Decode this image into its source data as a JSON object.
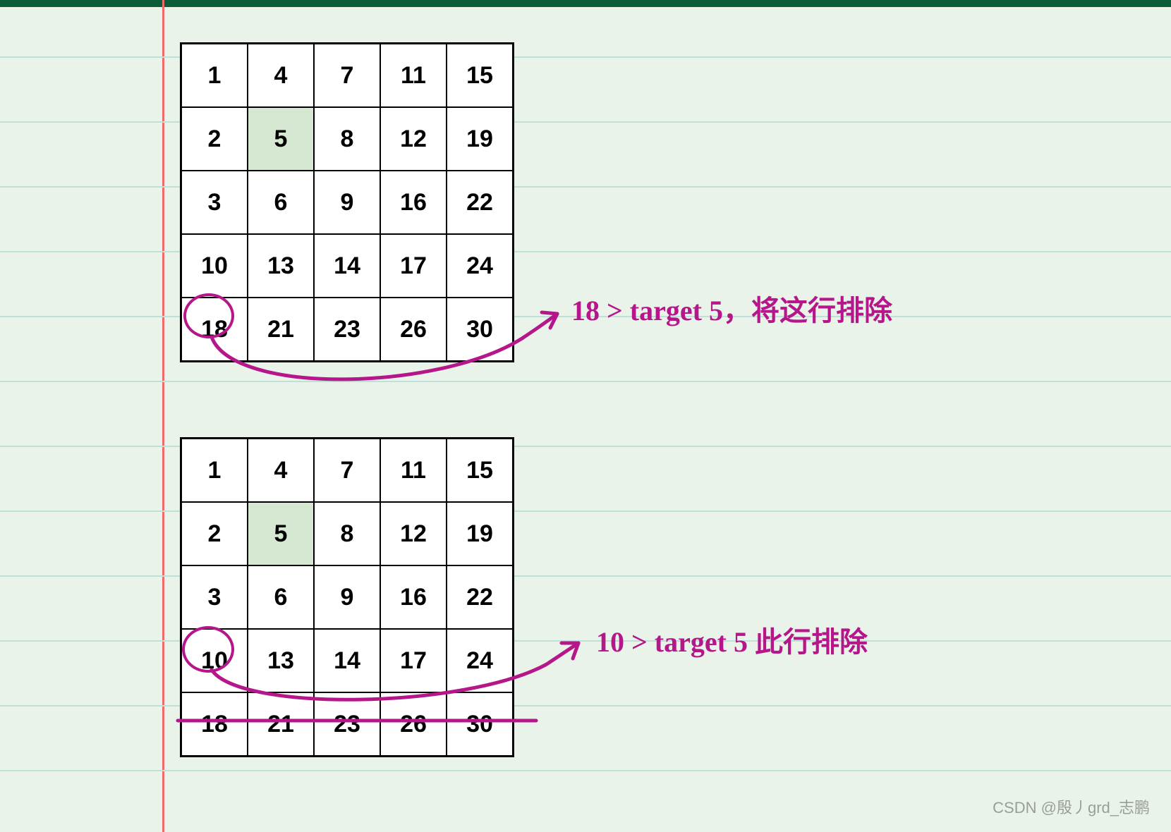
{
  "chart_data": [
    {
      "type": "table",
      "title": "Matrix step 1",
      "values": [
        [
          1,
          4,
          7,
          11,
          15
        ],
        [
          2,
          5,
          8,
          12,
          19
        ],
        [
          3,
          6,
          9,
          16,
          22
        ],
        [
          10,
          13,
          14,
          17,
          24
        ],
        [
          18,
          21,
          23,
          26,
          30
        ]
      ],
      "highlight": {
        "row": 1,
        "col": 1
      },
      "circled": {
        "row": 4,
        "col": 0
      },
      "annotation": "18 > target 5，将这行排除"
    },
    {
      "type": "table",
      "title": "Matrix step 2",
      "values": [
        [
          1,
          4,
          7,
          11,
          15
        ],
        [
          2,
          5,
          8,
          12,
          19
        ],
        [
          3,
          6,
          9,
          16,
          22
        ],
        [
          10,
          13,
          14,
          17,
          24
        ],
        [
          18,
          21,
          23,
          26,
          30
        ]
      ],
      "highlight": {
        "row": 1,
        "col": 1
      },
      "circled": {
        "row": 3,
        "col": 0
      },
      "strike_row": 4,
      "annotation": "10 > target 5  此行排除"
    }
  ],
  "watermark": "CSDN @殷丿grd_志鹏",
  "colors": {
    "ink": "#b5178b",
    "paper": "#eaf3e9",
    "rule": "#bfe0d6",
    "margin": "#f06a6a"
  }
}
